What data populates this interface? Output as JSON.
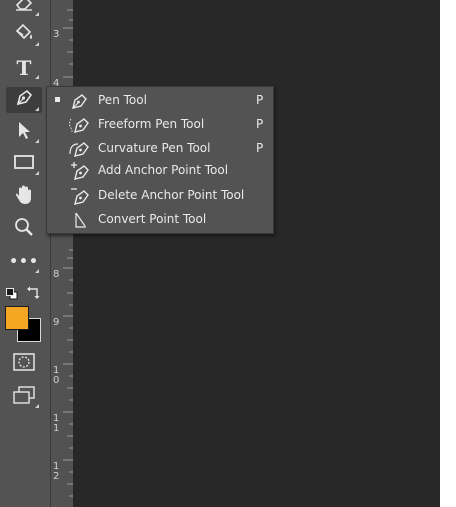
{
  "toolbar": {
    "tools": [
      "eraser-icon",
      "paint-bucket-icon",
      "type-icon",
      "pen-icon",
      "path-selection-icon",
      "rectangle-icon",
      "hand-icon",
      "zoom-icon",
      "more-icon"
    ],
    "type_label": "T",
    "more_label": "•••",
    "foreground_color": "#f5a623",
    "background_color": "#000000"
  },
  "ruler": {
    "labels": [
      "3",
      "4",
      "8",
      "9",
      "1\n0",
      "1\n1",
      "1\n2"
    ]
  },
  "flyout": {
    "items": [
      {
        "label": "Pen Tool",
        "shortcut": "P",
        "selected": true,
        "icon": "pen-icon"
      },
      {
        "label": "Freeform Pen Tool",
        "shortcut": "P",
        "selected": false,
        "icon": "freeform-pen-icon"
      },
      {
        "label": "Curvature Pen Tool",
        "shortcut": "P",
        "selected": false,
        "icon": "curvature-pen-icon"
      },
      {
        "label": "Add Anchor Point Tool",
        "shortcut": "",
        "selected": false,
        "icon": "add-anchor-point-icon"
      },
      {
        "label": "Delete Anchor Point Tool",
        "shortcut": "",
        "selected": false,
        "icon": "delete-anchor-point-icon"
      },
      {
        "label": "Convert Point Tool",
        "shortcut": "",
        "selected": false,
        "icon": "convert-point-icon"
      }
    ]
  }
}
